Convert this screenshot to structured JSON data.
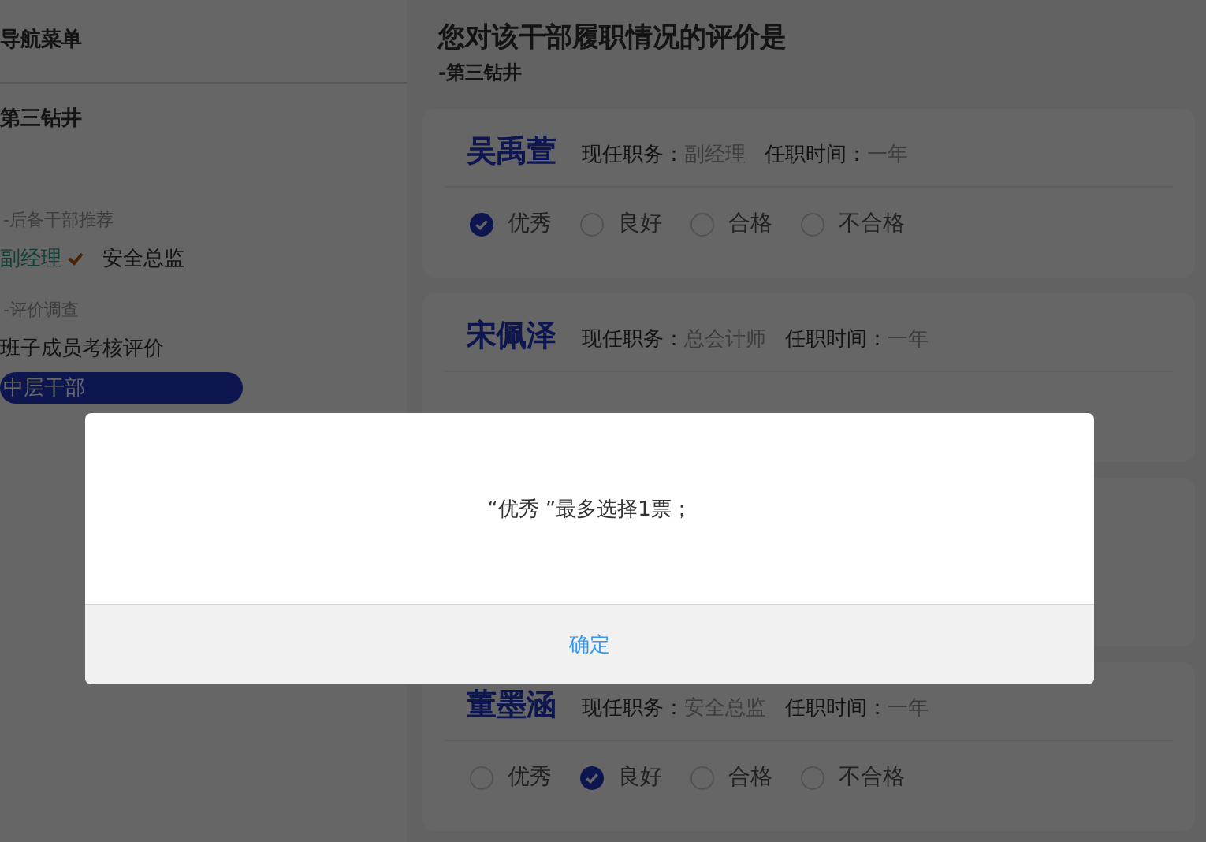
{
  "sidebar": {
    "title": "导航菜单",
    "unit": "第三钻井",
    "sections": [
      {
        "heading": "-后备干部推荐",
        "kind": "tags",
        "items": [
          {
            "label": "副经理",
            "selected": true
          },
          {
            "label": "安全总监",
            "selected": false
          }
        ]
      },
      {
        "heading": "-评价调查",
        "kind": "links",
        "items": [
          {
            "label": "班子成员考核评价",
            "selected": false
          },
          {
            "label": "中层干部",
            "selected": true
          }
        ]
      }
    ]
  },
  "main": {
    "title": "您对该干部履职情况的评价是",
    "subtitle": "-第三钻井",
    "cards": [
      {
        "kind": "person",
        "name": "吴禹萱",
        "position_label": "现任职务：",
        "position": "副经理",
        "tenure_label": "任职时间：",
        "tenure": "一年",
        "options": [
          {
            "label": "优秀",
            "selected": true
          },
          {
            "label": "良好",
            "selected": false
          },
          {
            "label": "合格",
            "selected": false
          },
          {
            "label": "不合格",
            "selected": false
          }
        ]
      },
      {
        "kind": "person",
        "name": "宋佩泽",
        "position_label": "现任职务：",
        "position": "总会计师",
        "tenure_label": "任职时间：",
        "tenure": "一年"
      },
      {
        "kind": "covered"
      },
      {
        "kind": "person",
        "name": "董墨涵",
        "position_label": "现任职务：",
        "position": "安全总监",
        "tenure_label": "任职时间：",
        "tenure": "一年",
        "options": [
          {
            "label": "优秀",
            "selected": false
          },
          {
            "label": "良好",
            "selected": true
          },
          {
            "label": "合格",
            "selected": false
          },
          {
            "label": "不合格",
            "selected": false
          }
        ]
      }
    ]
  },
  "dialog": {
    "message": "“优秀 ”最多选择1票；",
    "button": "确定"
  }
}
